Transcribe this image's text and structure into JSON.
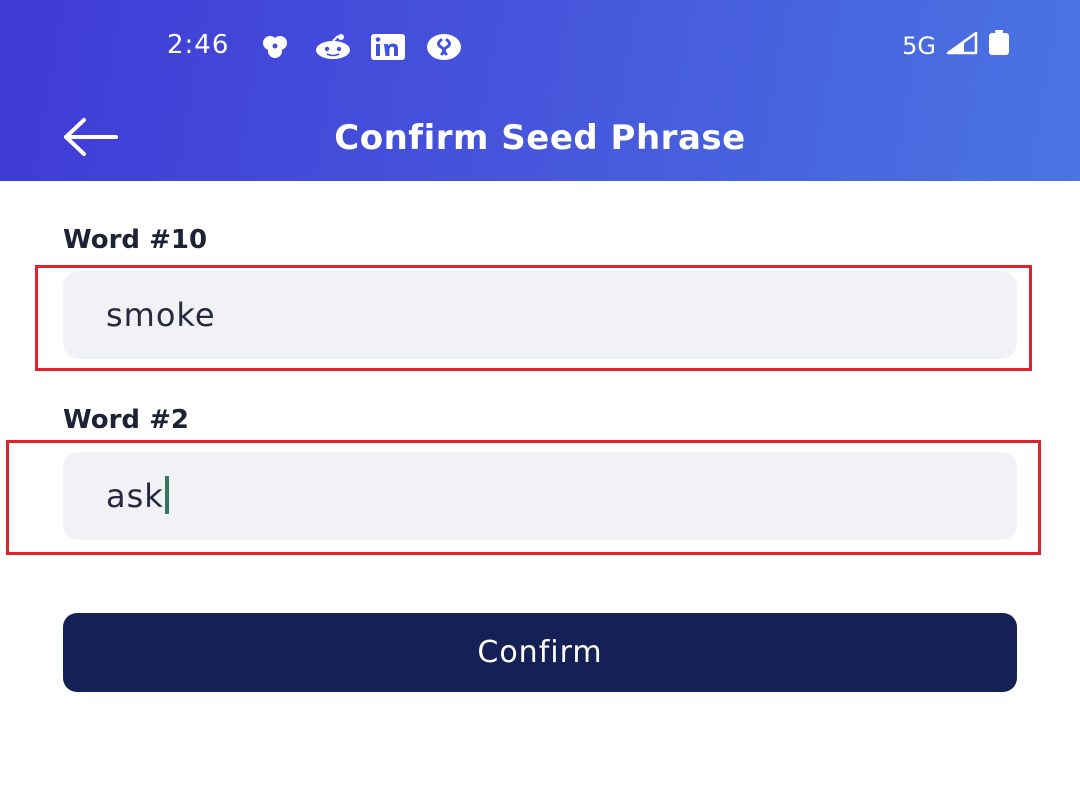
{
  "status_bar": {
    "time": "2:46",
    "network": "5G",
    "notification_icons": [
      "pinwheel-icon",
      "reddit-icon",
      "linkedin-icon",
      "shazam-icon"
    ],
    "system_icons": [
      "signal-icon",
      "battery-icon"
    ]
  },
  "header": {
    "title": "Confirm Seed Phrase",
    "gradient_colors": [
      "#3f3ad6",
      "#4a74e2"
    ]
  },
  "fields": [
    {
      "label": "Word #10",
      "value": "smoke"
    },
    {
      "label": "Word #2",
      "value": "ask"
    }
  ],
  "confirm_button": {
    "label": "Confirm",
    "color": "#142056"
  },
  "colors": {
    "highlight": "#e0222a",
    "caret": "#2f7a5c",
    "field_bg": "#f1f2f6"
  }
}
